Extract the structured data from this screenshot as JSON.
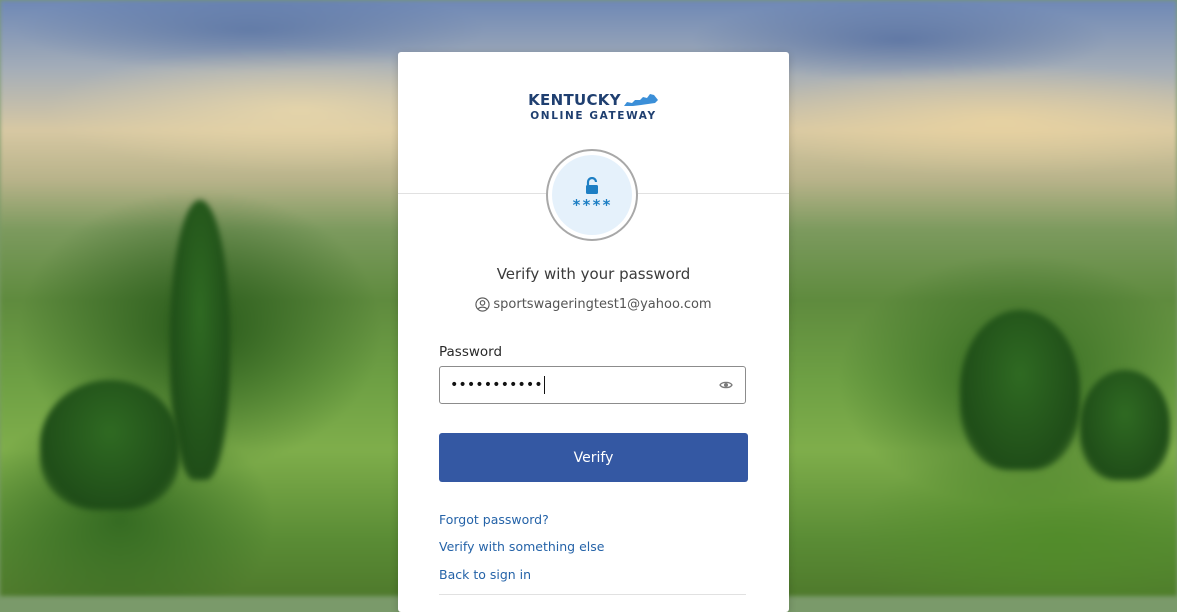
{
  "logo": {
    "title": "KENTUCKY",
    "subtitle": "ONLINE GATEWAY",
    "state_shape_color": "#3b8fd8",
    "text_color": "#1f3f70"
  },
  "badge": {
    "icon": "lock-open-icon",
    "stars": "****",
    "icon_color": "#1e7fc4"
  },
  "heading": "Verify with your password",
  "identity": {
    "icon": "user-circle-icon",
    "email": "sportswageringtest1@yahoo.com"
  },
  "password": {
    "label": "Password",
    "value": "•••••••••••",
    "toggle_icon": "eye-icon"
  },
  "verify_button": {
    "label": "Verify",
    "color": "#3458a3"
  },
  "links": {
    "forgot": "Forgot password?",
    "verify_else": "Verify with something else",
    "back": "Back to sign in"
  }
}
